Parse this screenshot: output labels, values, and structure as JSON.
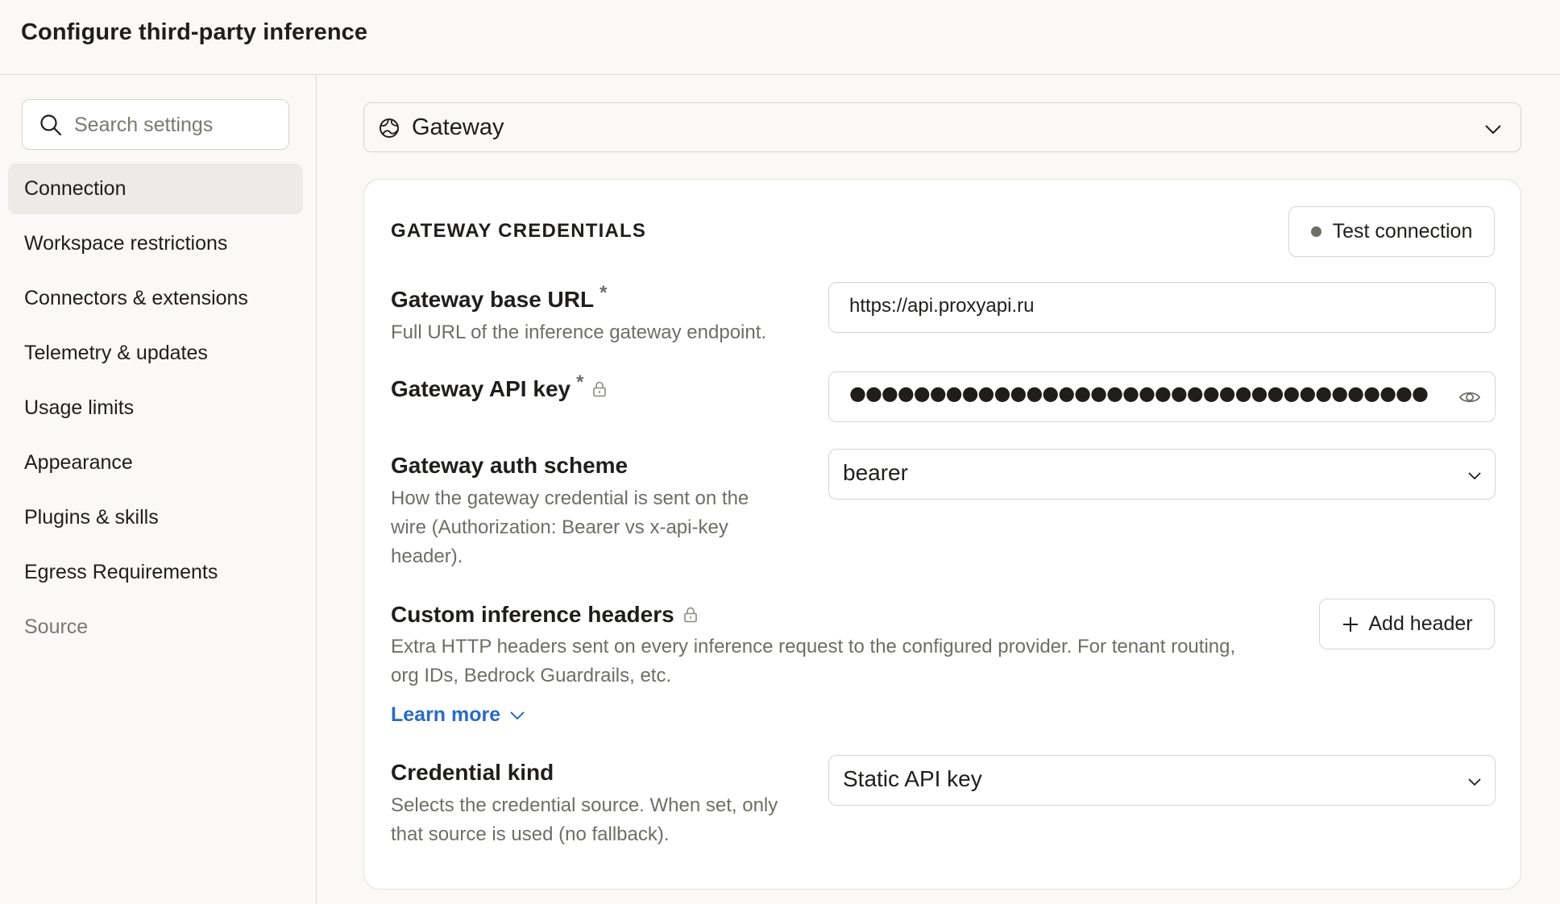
{
  "header": {
    "title": "Configure third-party inference"
  },
  "sidebar": {
    "search_placeholder": "Search settings",
    "items": [
      {
        "label": "Connection"
      },
      {
        "label": "Workspace restrictions"
      },
      {
        "label": "Connectors & extensions"
      },
      {
        "label": "Telemetry & updates"
      },
      {
        "label": "Usage limits"
      },
      {
        "label": "Appearance"
      },
      {
        "label": "Plugins & skills"
      },
      {
        "label": "Egress Requirements"
      },
      {
        "label": "Source"
      }
    ],
    "active_item": "Connection"
  },
  "provider": {
    "selected": "Gateway",
    "icon": "globe-icon"
  },
  "card": {
    "title": "GATEWAY CREDENTIALS",
    "test_button": "Test connection",
    "status_color": "#6f6d68",
    "fields": {
      "base_url": {
        "label": "Gateway base URL",
        "required_mark": "*",
        "description": "Full URL of the inference gateway endpoint.",
        "value": "https://api.proxyapi.ru"
      },
      "api_key": {
        "label": "Gateway API key",
        "required_mark": "*",
        "masked_value": "●●●●●●●●●●●●●●●●●●●●●●●●●●●●●●●●●●●●"
      },
      "auth_scheme": {
        "label": "Gateway auth scheme",
        "description_lines": [
          "How the gateway credential is sent on the",
          "wire (Authorization: Bearer vs x-api-key",
          "header)."
        ],
        "value": "bearer"
      },
      "custom_headers": {
        "label": "Custom inference headers",
        "description_lines": [
          "Extra HTTP headers sent on every inference request to the configured provider. For tenant routing,",
          "org IDs, Bedrock Guardrails, etc."
        ],
        "add_button": "Add header",
        "learn_more": "Learn more"
      },
      "credential_kind": {
        "label": "Credential kind",
        "description_lines": [
          "Selects the credential source. When set, only",
          "that source is used (no fallback)."
        ],
        "value": "Static API key"
      }
    }
  },
  "colors": {
    "accent_link": "#2c6bbf",
    "active_nav_bg": "#ecebe7"
  }
}
